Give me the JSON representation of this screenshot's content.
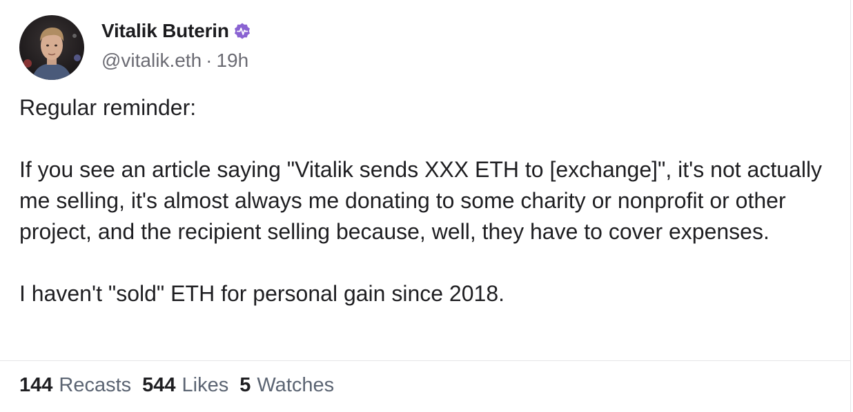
{
  "author": {
    "name": "Vitalik Buterin",
    "handle": "@vitalik.eth",
    "separator": "·",
    "time": "19h",
    "badge_icon": "verified-pulse-icon",
    "badge_color": "#8a63d2"
  },
  "post": {
    "paragraphs": [
      "Regular reminder:",
      "If you see an article saying \"Vitalik sends XXX ETH to [exchange]\", it's not actually me selling, it's almost always me donating to some charity or nonprofit or other project, and the recipient selling because, well, they have to cover expenses.",
      "I haven't \"sold\" ETH for personal gain since 2018."
    ]
  },
  "stats": {
    "recasts_count": "144",
    "recasts_label": "Recasts",
    "likes_count": "544",
    "likes_label": "Likes",
    "watches_count": "5",
    "watches_label": "Watches"
  }
}
